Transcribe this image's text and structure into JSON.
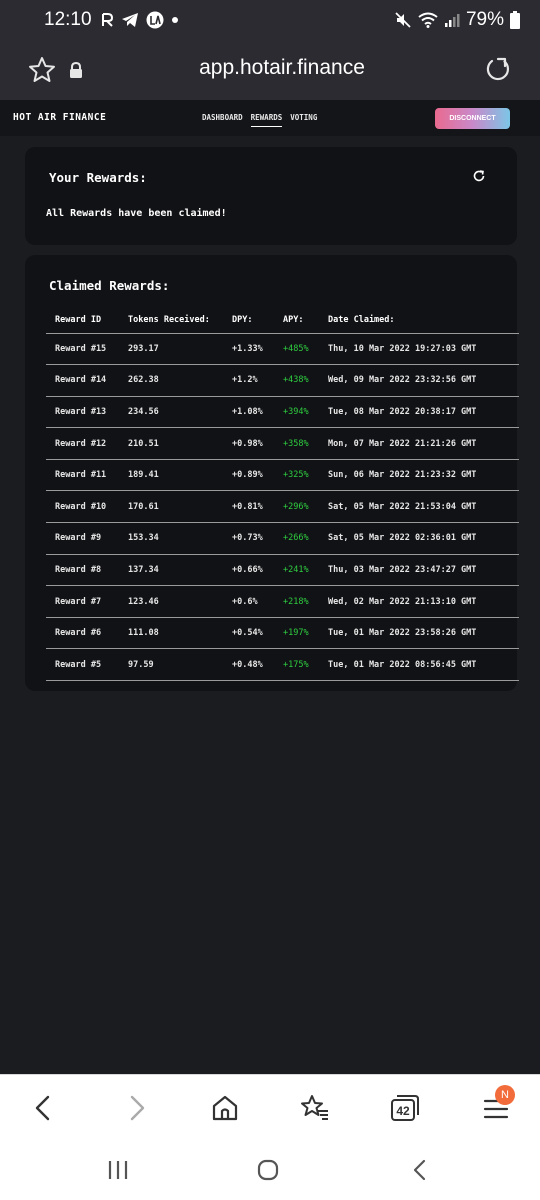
{
  "status_bar": {
    "time": "12:10",
    "battery": "79%"
  },
  "browser": {
    "url": "app.hotair.finance",
    "tab_count": "42",
    "menu_badge": "N"
  },
  "site_nav": {
    "brand": "HOT AIR FINANCE",
    "links": [
      "DASHBOARD",
      "REWARDS",
      "VOTING"
    ],
    "active_link": "REWARDS",
    "disconnect_label": "DISCONNECT"
  },
  "your_rewards": {
    "title": "Your Rewards:",
    "message": "All Rewards have been claimed!"
  },
  "claimed_rewards": {
    "title": "Claimed Rewards:",
    "headers": [
      "Reward ID",
      "Tokens Received:",
      "DPY:",
      "APY:",
      "Date Claimed:"
    ],
    "rows": [
      [
        "Reward #15",
        "293.17",
        "+1.33%",
        "+485%",
        "Thu, 10 Mar 2022 19:27:03 GMT"
      ],
      [
        "Reward #14",
        "262.38",
        "+1.2%",
        "+438%",
        "Wed, 09 Mar 2022 23:32:56 GMT"
      ],
      [
        "Reward #13",
        "234.56",
        "+1.08%",
        "+394%",
        "Tue, 08 Mar 2022 20:38:17 GMT"
      ],
      [
        "Reward #12",
        "210.51",
        "+0.98%",
        "+358%",
        "Mon, 07 Mar 2022 21:21:26 GMT"
      ],
      [
        "Reward #11",
        "189.41",
        "+0.89%",
        "+325%",
        "Sun, 06 Mar 2022 21:23:32 GMT"
      ],
      [
        "Reward #10",
        "170.61",
        "+0.81%",
        "+296%",
        "Sat, 05 Mar 2022 21:53:04 GMT"
      ],
      [
        "Reward #9",
        "153.34",
        "+0.73%",
        "+266%",
        "Sat, 05 Mar 2022 02:36:01 GMT"
      ],
      [
        "Reward #8",
        "137.34",
        "+0.66%",
        "+241%",
        "Thu, 03 Mar 2022 23:47:27 GMT"
      ],
      [
        "Reward #7",
        "123.46",
        "+0.6%",
        "+218%",
        "Wed, 02 Mar 2022 21:13:10 GMT"
      ],
      [
        "Reward #6",
        "111.08",
        "+0.54%",
        "+197%",
        "Tue, 01 Mar 2022 23:58:26 GMT"
      ],
      [
        "Reward #5",
        "97.59",
        "+0.48%",
        "+175%",
        "Tue, 01 Mar 2022 08:56:45 GMT"
      ]
    ]
  },
  "colors": {
    "page_bg": "#1b1c20",
    "card_bg": "#111215",
    "apy_green": "#2ecc40",
    "disconnect_gradient": [
      "#e96a8f",
      "#7cc6e6"
    ],
    "badge_orange": "#f26b3a"
  },
  "icons": {
    "status": [
      "r-app-icon",
      "telegram-icon",
      "la-app-icon",
      "dot-icon",
      "mute-icon",
      "wifi-icon",
      "signal-icon",
      "battery-icon"
    ],
    "browser": [
      "star-icon",
      "lock-icon",
      "reload-icon",
      "back-icon",
      "forward-icon",
      "home-icon",
      "bookmarks-icon",
      "tabs-icon",
      "menu-icon"
    ],
    "system": [
      "recent-apps-icon",
      "home-circle-icon",
      "system-back-icon"
    ]
  }
}
